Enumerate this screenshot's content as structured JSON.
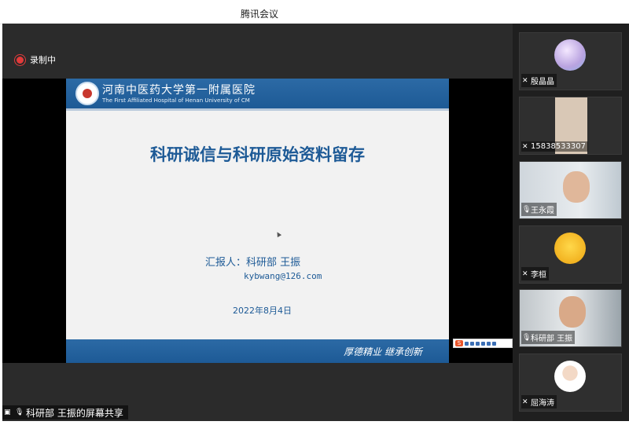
{
  "window": {
    "title": "腾讯会议"
  },
  "recording": {
    "label": "录制中"
  },
  "slide": {
    "header_cn": "河南中医药大学第一附属医院",
    "header_en": "The First Affiliated Hospital of Henan University of CM",
    "title": "科研诚信与科研原始资料留存",
    "reporter": "汇报人：科研部 王振",
    "email": "kybwang@126.com",
    "date": "2022年8月4日",
    "motto": "厚德精业  继承创新"
  },
  "share_label": "科研部 王振的屏幕共享",
  "participants": [
    {
      "name": "殷晶晶",
      "mic": "muted",
      "type": "avatar",
      "color": "#c9b8e6"
    },
    {
      "name": "15838533307",
      "mic": "muted",
      "type": "video"
    },
    {
      "name": "王永霞",
      "mic": "on",
      "type": "video"
    },
    {
      "name": "李桓",
      "mic": "muted",
      "type": "avatar",
      "color": "#f4c542"
    },
    {
      "name": "科研部 王振",
      "mic": "on",
      "type": "video"
    },
    {
      "name": "屈海涛",
      "mic": "muted",
      "type": "avatar",
      "color": "#ffffff"
    }
  ]
}
